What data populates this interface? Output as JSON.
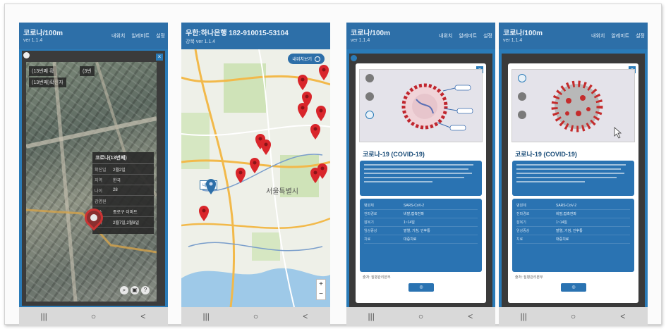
{
  "accent_color": "#2d6fa8",
  "pin_color": "#d9262b",
  "phones": [
    {
      "title": "코로나/100m",
      "subtitle": "ver 1.1.4",
      "menu": [
        "내위치",
        "알레미트",
        "설정"
      ]
    },
    {
      "title": "우한:하나은행 182-910015-53104",
      "subtitle": "강북 ver 1.1.4",
      "menu": []
    },
    {
      "title": "코로나/100m",
      "subtitle": "ver 1.1.4",
      "menu": [
        "내위치",
        "알레미트",
        "설정"
      ]
    },
    {
      "title": "코로나/100m",
      "subtitle": "ver 1.1.4",
      "menu": [
        "내위치",
        "알레미트",
        "설정"
      ]
    }
  ],
  "satellite": {
    "tag_left": "(13번째 확",
    "tag_right": "(3번",
    "tag_second": "(13번째)확진자",
    "info_title": "코로나(13번째)",
    "rows": [
      {
        "k": "확진일",
        "v": "2월2일"
      },
      {
        "k": "지역",
        "v": "한국"
      },
      {
        "k": "나이",
        "v": "28"
      },
      {
        "k": "감염원",
        "v": ""
      },
      {
        "k": "장소",
        "v": "종로구 이마트"
      },
      {
        "k": "날짜",
        "v": "2월7일,2월8일"
      }
    ]
  },
  "map": {
    "top_button": "내위치보기",
    "city_label": "서울특별시",
    "my_label": "내위치"
  },
  "covid": {
    "heading": "코로나-19 (COVID-19)",
    "table_rows": [
      {
        "k": "병원체",
        "v": "SARS-CoV-2"
      },
      {
        "k": "전파경로",
        "v": "비말,접촉전파"
      },
      {
        "k": "잠복기",
        "v": "1~14일"
      },
      {
        "k": "임상증상",
        "v": "발열, 기침, 인후통"
      },
      {
        "k": "치료",
        "v": "대증치료"
      }
    ],
    "footer": "출처: 질병관리본부",
    "button_icon": "confirm-icon"
  },
  "navbar_icons": [
    "|||",
    "○",
    "<"
  ]
}
